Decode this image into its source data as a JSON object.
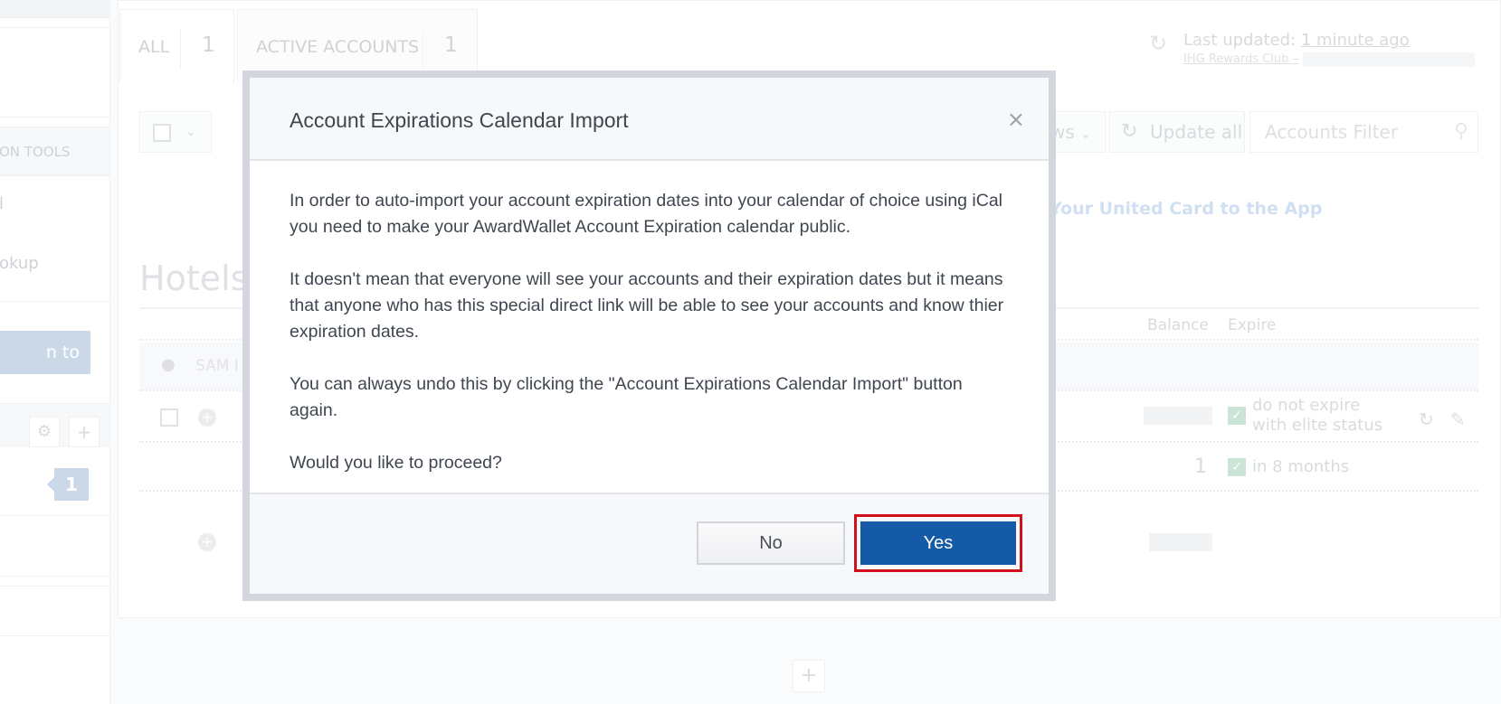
{
  "sidebar": {
    "section_label": "ON TOOLS",
    "item_1": "l",
    "item_2": "okup",
    "track_button": "n to Track",
    "badge_count": "1"
  },
  "tabs": [
    {
      "label": "ALL",
      "count": "1"
    },
    {
      "label": "ACTIVE ACCOUNTS",
      "count": "1"
    }
  ],
  "status": {
    "last_updated_prefix": "Last updated:",
    "last_updated_time": "1 minute ago",
    "last_program": "IHG Rewards Club –"
  },
  "toolbar": {
    "views_label": "ws",
    "update_all": "Update all",
    "filter_placeholder": "Accounts Filter"
  },
  "promo_link": "Your United Card to the App",
  "section": {
    "title": "Hotels",
    "col_balance": "Balance",
    "col_expire": "Expire",
    "owner": "SAM I"
  },
  "rows": [
    {
      "expire": "do not expire with elite status",
      "expire_line1": "do not expire",
      "expire_line2": "with elite status"
    },
    {
      "balance": "1",
      "expire": "in 8 months"
    }
  ],
  "modal": {
    "title": "Account Expirations Calendar Import",
    "close": "×",
    "paragraphs": [
      "In order to auto-import your account expiration dates into your calendar of choice using iCal you need to make your AwardWallet Account Expiration calendar public.",
      "It doesn't mean that everyone will see your accounts and their expiration dates but it means that anyone who has this special direct link will be able to see your accounts and know thier expiration dates.",
      "You can always undo this by clicking the \"Account Expirations Calendar Import\" button again.",
      "Would you like to proceed?"
    ],
    "no_label": "No",
    "yes_label": "Yes"
  },
  "colors": {
    "primary": "#145aa6",
    "highlight": "#d0111b",
    "overlay_border": "#d3d6dc"
  }
}
